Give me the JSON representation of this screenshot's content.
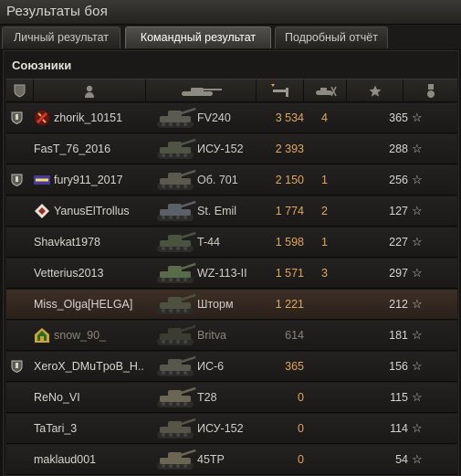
{
  "window": {
    "title": "Результаты боя"
  },
  "tabs": [
    {
      "label": "Личный результат",
      "active": false
    },
    {
      "label": "Командный результат",
      "active": true
    },
    {
      "label": "Подробный отчёт",
      "active": false
    }
  ],
  "team": {
    "title": "Союзники",
    "columns": [
      {
        "name": "rank",
        "icon": "rank-shield-icon"
      },
      {
        "name": "player",
        "icon": "player-icon"
      },
      {
        "name": "vehicle",
        "icon": "tank-icon"
      },
      {
        "name": "damage",
        "icon": "damage-icon",
        "sorted": true
      },
      {
        "name": "kills",
        "icon": "kills-icon"
      },
      {
        "name": "experience",
        "icon": "star-icon"
      },
      {
        "name": "medals",
        "icon": "medal-icon"
      }
    ],
    "rows": [
      {
        "player": "zhorik_10151",
        "vehicle": "FV240",
        "damage": "3 534",
        "kills": "4",
        "xp": "365",
        "rank": true,
        "clan": "red"
      },
      {
        "player": "FasT_76_2016",
        "vehicle": "ИСУ-152",
        "damage": "2 393",
        "kills": "",
        "xp": "288",
        "rank": false,
        "clan": ""
      },
      {
        "player": "fury911_2017",
        "vehicle": "Об. 701",
        "damage": "2 150",
        "kills": "1",
        "xp": "256",
        "rank": true,
        "clan": "yusha"
      },
      {
        "player": "YanusElTrollus",
        "vehicle": "St. Emil",
        "damage": "1 774",
        "kills": "2",
        "xp": "127",
        "rank": false,
        "clan": "diamond"
      },
      {
        "player": "Shavkat1978",
        "vehicle": "T-44",
        "damage": "1 598",
        "kills": "1",
        "xp": "227",
        "rank": false,
        "clan": ""
      },
      {
        "player": "Vetterius2013",
        "vehicle": "WZ-113-II",
        "damage": "1 571",
        "kills": "3",
        "xp": "297",
        "rank": false,
        "clan": ""
      },
      {
        "player": "Miss_Olga[HELGA]",
        "vehicle": "Шторм",
        "damage": "1 221",
        "kills": "",
        "xp": "212",
        "rank": false,
        "clan": "",
        "highlight": true
      },
      {
        "player": "snow_90_",
        "vehicle": "Britva",
        "damage": "614",
        "kills": "",
        "xp": "181",
        "rank": false,
        "clan": "house",
        "dead": true
      },
      {
        "player": "XeroX_DMuTpoB_H..",
        "vehicle": "ИС-6",
        "damage": "365",
        "kills": "",
        "xp": "156",
        "rank": true,
        "clan": ""
      },
      {
        "player": "ReNo_VI",
        "vehicle": "T28",
        "damage": "0",
        "kills": "",
        "xp": "115",
        "rank": false,
        "clan": ""
      },
      {
        "player": "TaTari_3",
        "vehicle": "ИСУ-152",
        "damage": "0",
        "kills": "",
        "xp": "114",
        "rank": false,
        "clan": ""
      },
      {
        "player": "maklaud001",
        "vehicle": "45TP",
        "damage": "0",
        "kills": "",
        "xp": "54",
        "rank": false,
        "clan": ""
      }
    ]
  },
  "colors": {
    "damage": "#e0a660",
    "highlight_row": "#3d2f26",
    "text": "#d8d5cc"
  }
}
